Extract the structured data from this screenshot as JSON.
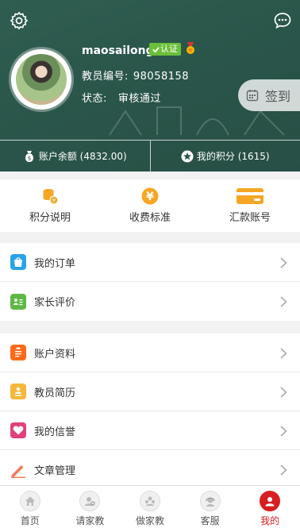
{
  "colors": {
    "header_bg": "#2a554a",
    "accent_orange": "#f5a623",
    "active_red": "#d71f1f",
    "badge_green": "#6cbf3a"
  },
  "header": {
    "username": "maosailong",
    "verified_badge": "认证",
    "teacher_no_label": "教员编号:",
    "teacher_no": "98058158",
    "status_label": "状态:",
    "status_value": "审核通过",
    "signin_label": "签到"
  },
  "stats": {
    "balance_label": "账户余额 (4832.00)",
    "points_label": "我的积分 (1615)"
  },
  "quick": [
    {
      "label": "积分说明",
      "icon": "coin-stack-icon"
    },
    {
      "label": "收费标准",
      "icon": "yen-icon"
    },
    {
      "label": "汇款账号",
      "icon": "bank-card-icon"
    }
  ],
  "menu_group1": [
    {
      "label": "我的订单",
      "icon": "order-bag-icon"
    },
    {
      "label": "家长评价",
      "icon": "review-card-icon"
    }
  ],
  "menu_group2": [
    {
      "label": "账户资料",
      "icon": "clipboard-icon"
    },
    {
      "label": "教员简历",
      "icon": "resume-icon"
    },
    {
      "label": "我的信誉",
      "icon": "heart-icon"
    },
    {
      "label": "文章管理",
      "icon": "pencil-icon"
    }
  ],
  "tabbar": [
    {
      "label": "首页",
      "icon": "home-icon",
      "active": false
    },
    {
      "label": "请家教",
      "icon": "find-tutor-icon",
      "active": false
    },
    {
      "label": "做家教",
      "icon": "be-tutor-icon",
      "active": false
    },
    {
      "label": "客服",
      "icon": "service-icon",
      "active": false
    },
    {
      "label": "我的",
      "icon": "my-profile-icon",
      "active": true
    }
  ]
}
